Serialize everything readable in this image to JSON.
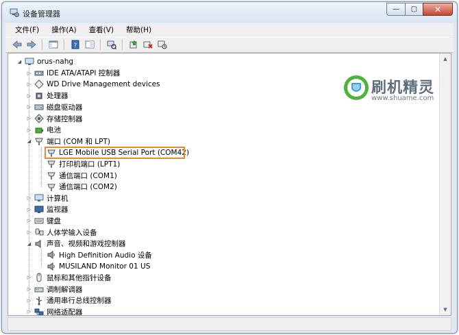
{
  "window": {
    "title": "设备管理器"
  },
  "caption": {
    "minimize": "—",
    "maximize": "▢",
    "close": "✕"
  },
  "menu": [
    "文件(F)",
    "操作(A)",
    "查看(V)",
    "帮助(H)"
  ],
  "watermark": {
    "title": "刷机精灵",
    "url": "www.shuame.com"
  },
  "tree": {
    "root": "orus-nahg",
    "nodes": [
      {
        "label": "IDE ATA/ATAPI 控制器",
        "icon": "ide-controller-icon",
        "expander": "collapsed"
      },
      {
        "label": "WD Drive Management devices",
        "icon": "wd-device-icon",
        "expander": "collapsed"
      },
      {
        "label": "处理器",
        "icon": "processor-icon",
        "expander": "collapsed"
      },
      {
        "label": "磁盘驱动器",
        "icon": "disk-drive-icon",
        "expander": "collapsed"
      },
      {
        "label": "存储控制器",
        "icon": "storage-controller-icon",
        "expander": "collapsed"
      },
      {
        "label": "电池",
        "icon": "battery-icon",
        "expander": "collapsed"
      },
      {
        "label": "端口 (COM 和 LPT)",
        "icon": "port-icon",
        "expander": "expanded",
        "children": [
          {
            "label": "LGE Mobile USB Serial Port (COM42)",
            "icon": "port-icon",
            "highlighted": true
          },
          {
            "label": "打印机端口 (LPT1)",
            "icon": "port-icon"
          },
          {
            "label": "通信端口 (COM1)",
            "icon": "port-icon"
          },
          {
            "label": "通信端口 (COM2)",
            "icon": "port-icon"
          }
        ]
      },
      {
        "label": "计算机",
        "icon": "computer-icon",
        "expander": "collapsed"
      },
      {
        "label": "监视器",
        "icon": "monitor-icon",
        "expander": "collapsed"
      },
      {
        "label": "键盘",
        "icon": "keyboard-icon",
        "expander": "collapsed"
      },
      {
        "label": "人体学输入设备",
        "icon": "hid-icon",
        "expander": "collapsed"
      },
      {
        "label": "声音、视频和游戏控制器",
        "icon": "sound-icon",
        "expander": "expanded",
        "children": [
          {
            "label": "High Definition Audio 设备",
            "icon": "speaker-icon"
          },
          {
            "label": "MUSILAND Monitor 01 US",
            "icon": "speaker-icon"
          }
        ]
      },
      {
        "label": "鼠标和其他指针设备",
        "icon": "mouse-icon",
        "expander": "collapsed"
      },
      {
        "label": "调制解调器",
        "icon": "modem-icon",
        "expander": "collapsed"
      },
      {
        "label": "通用串行总线控制器",
        "icon": "usb-icon",
        "expander": "collapsed"
      },
      {
        "label": "网络适配器",
        "icon": "network-icon",
        "expander": "collapsed"
      }
    ]
  },
  "colors": {
    "highlight_border": "#e98a2b",
    "window_frame": "#dfe8f3"
  }
}
